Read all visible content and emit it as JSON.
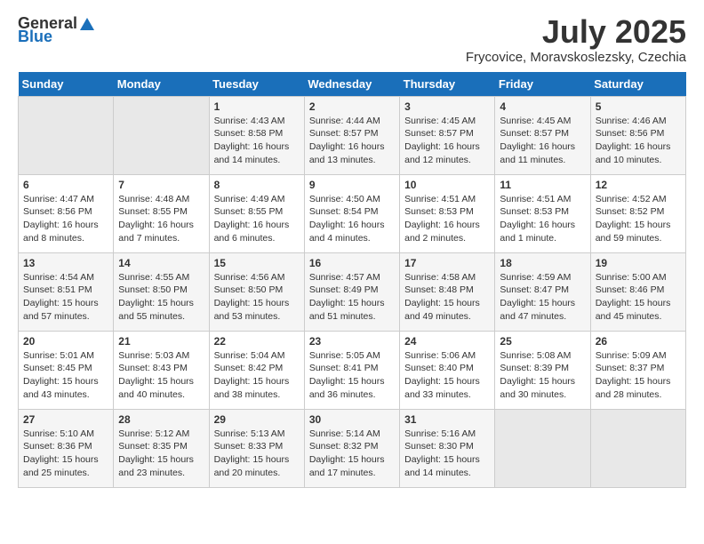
{
  "header": {
    "logo": {
      "general": "General",
      "blue": "Blue"
    },
    "title": "July 2025",
    "location": "Frycovice, Moravskoslezsky, Czechia"
  },
  "weekdays": [
    "Sunday",
    "Monday",
    "Tuesday",
    "Wednesday",
    "Thursday",
    "Friday",
    "Saturday"
  ],
  "weeks": [
    [
      {
        "day": "",
        "info": ""
      },
      {
        "day": "",
        "info": ""
      },
      {
        "day": "1",
        "info": "Sunrise: 4:43 AM\nSunset: 8:58 PM\nDaylight: 16 hours and 14 minutes."
      },
      {
        "day": "2",
        "info": "Sunrise: 4:44 AM\nSunset: 8:57 PM\nDaylight: 16 hours and 13 minutes."
      },
      {
        "day": "3",
        "info": "Sunrise: 4:45 AM\nSunset: 8:57 PM\nDaylight: 16 hours and 12 minutes."
      },
      {
        "day": "4",
        "info": "Sunrise: 4:45 AM\nSunset: 8:57 PM\nDaylight: 16 hours and 11 minutes."
      },
      {
        "day": "5",
        "info": "Sunrise: 4:46 AM\nSunset: 8:56 PM\nDaylight: 16 hours and 10 minutes."
      }
    ],
    [
      {
        "day": "6",
        "info": "Sunrise: 4:47 AM\nSunset: 8:56 PM\nDaylight: 16 hours and 8 minutes."
      },
      {
        "day": "7",
        "info": "Sunrise: 4:48 AM\nSunset: 8:55 PM\nDaylight: 16 hours and 7 minutes."
      },
      {
        "day": "8",
        "info": "Sunrise: 4:49 AM\nSunset: 8:55 PM\nDaylight: 16 hours and 6 minutes."
      },
      {
        "day": "9",
        "info": "Sunrise: 4:50 AM\nSunset: 8:54 PM\nDaylight: 16 hours and 4 minutes."
      },
      {
        "day": "10",
        "info": "Sunrise: 4:51 AM\nSunset: 8:53 PM\nDaylight: 16 hours and 2 minutes."
      },
      {
        "day": "11",
        "info": "Sunrise: 4:51 AM\nSunset: 8:53 PM\nDaylight: 16 hours and 1 minute."
      },
      {
        "day": "12",
        "info": "Sunrise: 4:52 AM\nSunset: 8:52 PM\nDaylight: 15 hours and 59 minutes."
      }
    ],
    [
      {
        "day": "13",
        "info": "Sunrise: 4:54 AM\nSunset: 8:51 PM\nDaylight: 15 hours and 57 minutes."
      },
      {
        "day": "14",
        "info": "Sunrise: 4:55 AM\nSunset: 8:50 PM\nDaylight: 15 hours and 55 minutes."
      },
      {
        "day": "15",
        "info": "Sunrise: 4:56 AM\nSunset: 8:50 PM\nDaylight: 15 hours and 53 minutes."
      },
      {
        "day": "16",
        "info": "Sunrise: 4:57 AM\nSunset: 8:49 PM\nDaylight: 15 hours and 51 minutes."
      },
      {
        "day": "17",
        "info": "Sunrise: 4:58 AM\nSunset: 8:48 PM\nDaylight: 15 hours and 49 minutes."
      },
      {
        "day": "18",
        "info": "Sunrise: 4:59 AM\nSunset: 8:47 PM\nDaylight: 15 hours and 47 minutes."
      },
      {
        "day": "19",
        "info": "Sunrise: 5:00 AM\nSunset: 8:46 PM\nDaylight: 15 hours and 45 minutes."
      }
    ],
    [
      {
        "day": "20",
        "info": "Sunrise: 5:01 AM\nSunset: 8:45 PM\nDaylight: 15 hours and 43 minutes."
      },
      {
        "day": "21",
        "info": "Sunrise: 5:03 AM\nSunset: 8:43 PM\nDaylight: 15 hours and 40 minutes."
      },
      {
        "day": "22",
        "info": "Sunrise: 5:04 AM\nSunset: 8:42 PM\nDaylight: 15 hours and 38 minutes."
      },
      {
        "day": "23",
        "info": "Sunrise: 5:05 AM\nSunset: 8:41 PM\nDaylight: 15 hours and 36 minutes."
      },
      {
        "day": "24",
        "info": "Sunrise: 5:06 AM\nSunset: 8:40 PM\nDaylight: 15 hours and 33 minutes."
      },
      {
        "day": "25",
        "info": "Sunrise: 5:08 AM\nSunset: 8:39 PM\nDaylight: 15 hours and 30 minutes."
      },
      {
        "day": "26",
        "info": "Sunrise: 5:09 AM\nSunset: 8:37 PM\nDaylight: 15 hours and 28 minutes."
      }
    ],
    [
      {
        "day": "27",
        "info": "Sunrise: 5:10 AM\nSunset: 8:36 PM\nDaylight: 15 hours and 25 minutes."
      },
      {
        "day": "28",
        "info": "Sunrise: 5:12 AM\nSunset: 8:35 PM\nDaylight: 15 hours and 23 minutes."
      },
      {
        "day": "29",
        "info": "Sunrise: 5:13 AM\nSunset: 8:33 PM\nDaylight: 15 hours and 20 minutes."
      },
      {
        "day": "30",
        "info": "Sunrise: 5:14 AM\nSunset: 8:32 PM\nDaylight: 15 hours and 17 minutes."
      },
      {
        "day": "31",
        "info": "Sunrise: 5:16 AM\nSunset: 8:30 PM\nDaylight: 15 hours and 14 minutes."
      },
      {
        "day": "",
        "info": ""
      },
      {
        "day": "",
        "info": ""
      }
    ]
  ]
}
